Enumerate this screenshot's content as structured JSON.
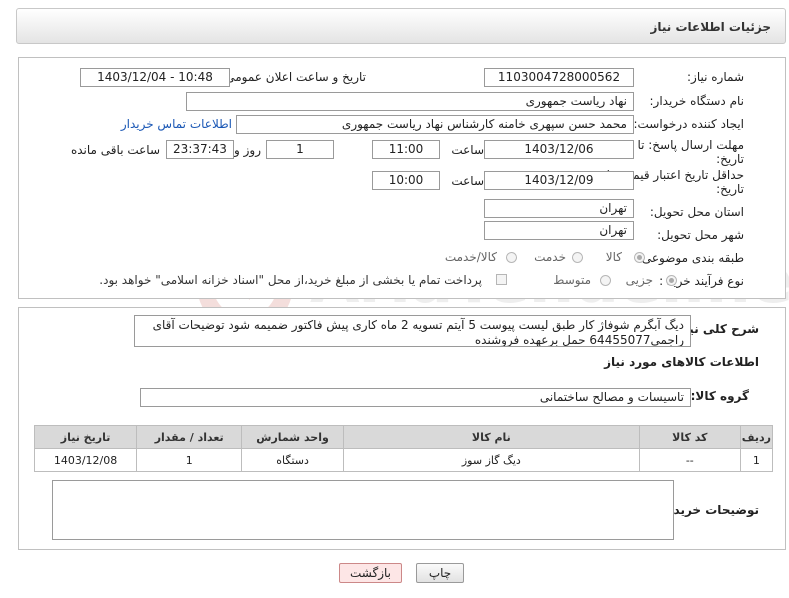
{
  "header": {
    "title": "جزئیات اطلاعات نیاز"
  },
  "fields": {
    "need_number": {
      "label": "شماره نیاز:",
      "value": "1103004728000562"
    },
    "announce": {
      "label": "تاریخ و ساعت اعلان عمومی:",
      "value": "1403/12/04 - 10:48"
    },
    "buyer_org": {
      "label": "نام دستگاه خریدار:",
      "value": "نهاد ریاست جمهوری"
    },
    "creator": {
      "label": "ایجاد کننده درخواست:",
      "value": "محمد حسن سپهری خامنه کارشناس نهاد ریاست جمهوری",
      "link": "اطلاعات تماس خریدار"
    },
    "reply_deadline": {
      "label1": "مهلت ارسال پاسخ: تا",
      "label2": "تاریخ:",
      "date": "1403/12/06",
      "time_label": "ساعت",
      "time": "11:00",
      "days": "1",
      "days_label": "روز و",
      "remaining": "23:37:43",
      "remaining_label": "ساعت باقی مانده"
    },
    "price_validity": {
      "label1": "حداقل تاریخ اعتبار قیمت: تا",
      "label2": "تاریخ:",
      "date": "1403/12/09",
      "time_label": "ساعت",
      "time": "10:00"
    },
    "province": {
      "label": "استان محل تحویل:",
      "value": "تهران"
    },
    "city": {
      "label": "شهر محل تحویل:",
      "value": "تهران"
    },
    "category": {
      "label": "طبقه بندی موضوعی:",
      "options": [
        "کالا",
        "خدمت",
        "کالا/خدمت"
      ],
      "selected": "کالا"
    },
    "process": {
      "label": "نوع فرآیند خرید :",
      "options": [
        "جزیی",
        "متوسط"
      ],
      "selected": "جزیی",
      "note": "پرداخت تمام یا بخشی از مبلغ خرید،از محل \"اسناد خزانه اسلامی\" خواهد بود."
    }
  },
  "description": {
    "label": "شرح کلی نیاز:",
    "text": "دیگ آبگرم شوفاژ کار طبق لیست پیوست 5 آیتم تسویه 2 ماه کاری پیش فاکتور ضمیمه شود توضیحات آقای راجمی64455077 حمل برعهده فروشنده"
  },
  "goods": {
    "section_title": "اطلاعات کالاهای مورد نیاز",
    "group_label": "گروه کالا:",
    "group_value": "تاسیسات و مصالح ساختمانی",
    "columns": [
      "ردیف",
      "کد کالا",
      "نام کالا",
      "واحد شمارش",
      "تعداد / مقدار",
      "تاریخ نیاز"
    ],
    "rows": [
      {
        "row": "1",
        "code": "--",
        "name": "دیگ گاز سوز",
        "unit": "دستگاه",
        "qty": "1",
        "date": "1403/12/08"
      }
    ]
  },
  "buyer_notes": {
    "label": "توضیحات خریدار:",
    "value": ""
  },
  "buttons": {
    "print": "چاپ",
    "back": "بازگشت"
  },
  "watermark": {
    "text": "AriaTender.net"
  },
  "colors": {
    "link": "#1a57b5",
    "back_button_bg": "#fde6e6",
    "header_bg": "#e4e4e4"
  }
}
